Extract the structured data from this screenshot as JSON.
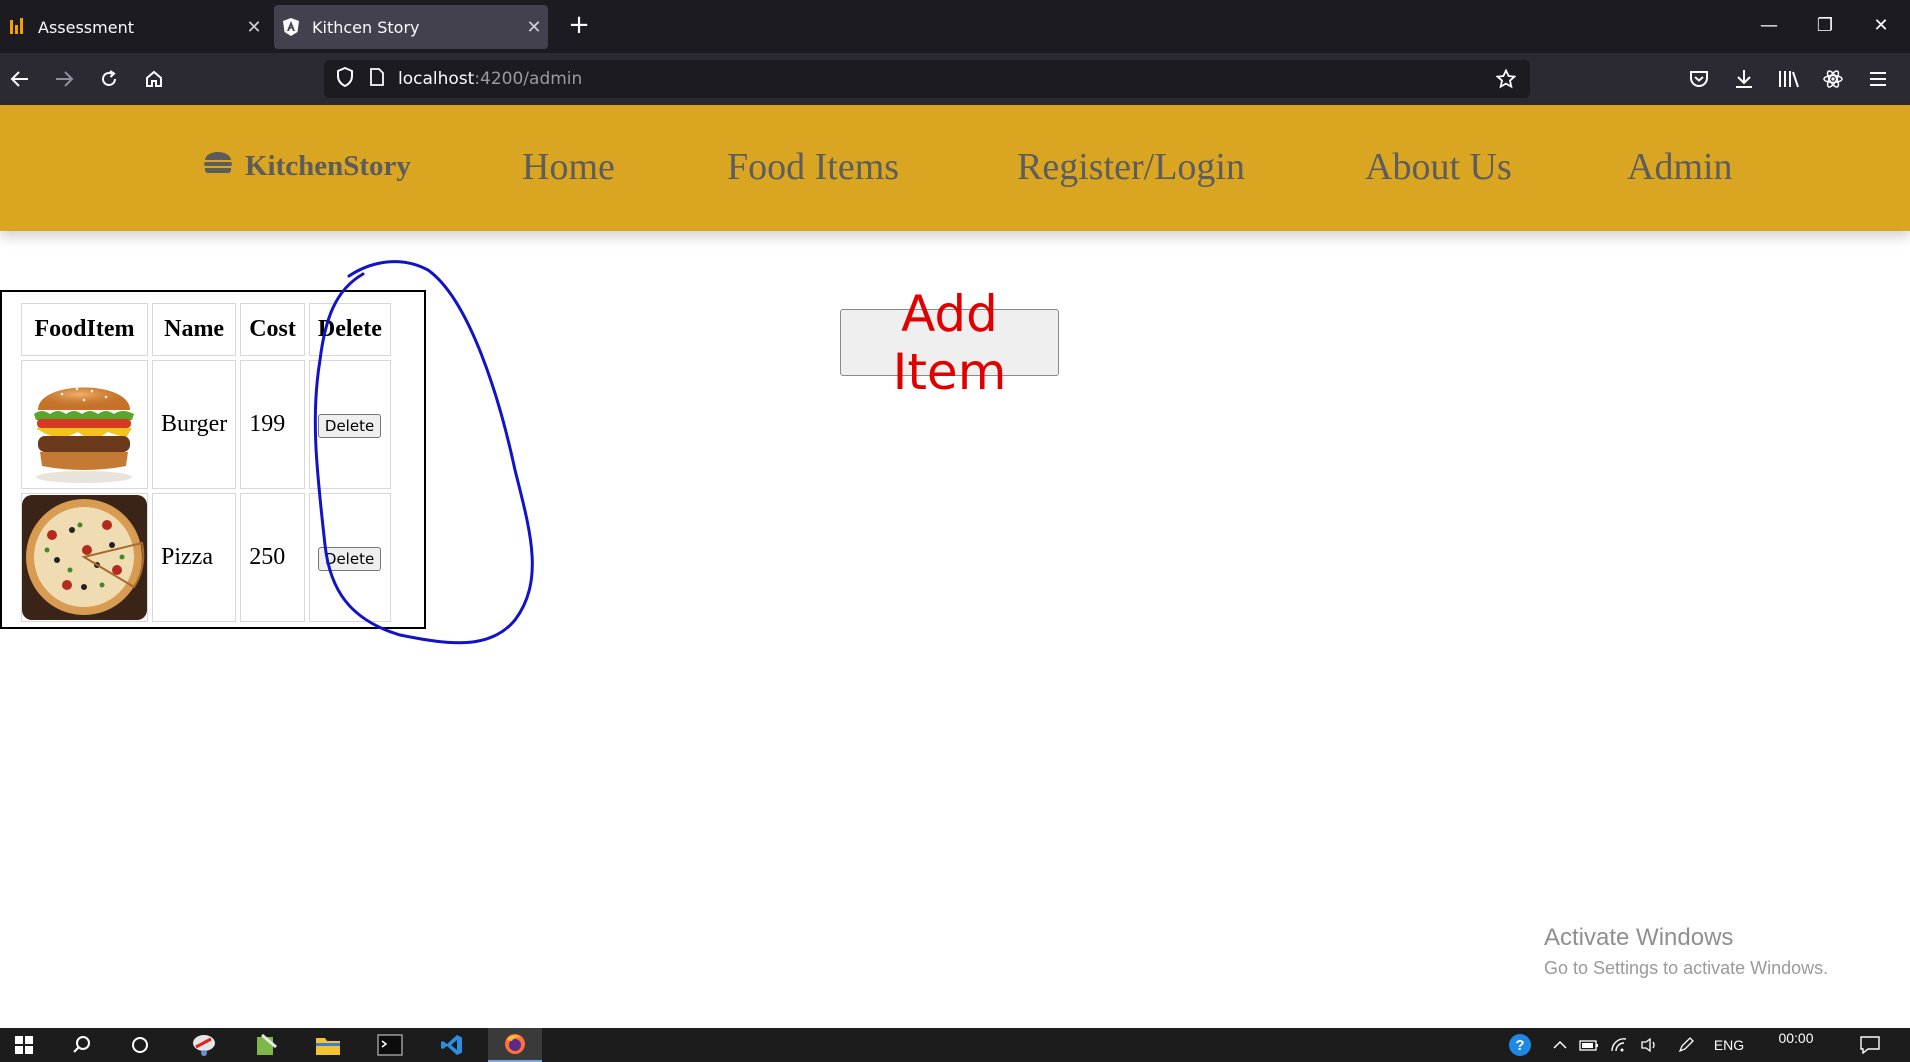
{
  "browser": {
    "tabs": [
      {
        "title": "Assessment",
        "active": false
      },
      {
        "title": "Kithcen Story",
        "active": true
      }
    ],
    "url_host": "localhost",
    "url_path": ":4200/admin"
  },
  "header": {
    "brand": "KitchenStory",
    "nav": [
      "Home",
      "Food Items",
      "Register/Login",
      "About Us",
      "Admin"
    ]
  },
  "table": {
    "headers": [
      "FoodItem",
      "Name",
      "Cost",
      "Delete"
    ],
    "rows": [
      {
        "name": "Burger",
        "cost": "199",
        "delete_label": "Delete"
      },
      {
        "name": "Pizza",
        "cost": "250",
        "delete_label": "Delete"
      }
    ]
  },
  "add_button": "Add Item",
  "watermark": {
    "line1": "Activate Windows",
    "line2": "Go to Settings to activate Windows."
  },
  "taskbar": {
    "language": "ENG",
    "time": "00:00"
  },
  "colors": {
    "header_bg": "#daa520",
    "nav_text": "#5d5d5d",
    "add_text": "#e00000",
    "annotation": "#1212c8"
  }
}
